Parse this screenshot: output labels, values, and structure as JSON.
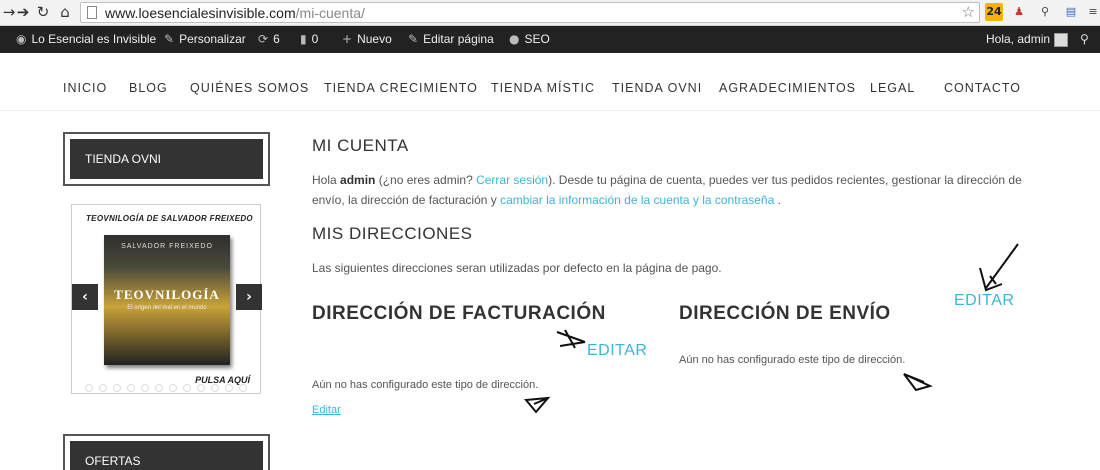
{
  "browser": {
    "url_host": "www.loesencialesinvisible.com",
    "url_path": "/mi-cuenta/",
    "ext_badge": "24"
  },
  "admin_bar": {
    "site_name": "Lo Esencial es Invisible",
    "customize": "Personalizar",
    "updates_count": "6",
    "comments_count": "0",
    "new": "Nuevo",
    "edit_page": "Editar página",
    "seo": "SEO",
    "greeting": "Hola, admin"
  },
  "nav": {
    "items": [
      "INICIO",
      "BLOG",
      "QUIÉNES SOMOS",
      "TIENDA CRECIMIENTO",
      "TIENDA MÍSTIC",
      "TIENDA OVNI",
      "AGRADECIMIENTOS",
      "LEGAL",
      "CONTACTO"
    ]
  },
  "sidebar": {
    "widget1_title": "TIENDA OVNI",
    "widget2_title": "OFERTAS",
    "slider_top_text": "TEOVNILOGÍA DE SALVADOR FREIXEDO",
    "book_author": "SALVADOR FREIXEDO",
    "book_title": "TEOVNILOGÍA",
    "book_subtitle": "El origen del mal en el mundo",
    "slider_bottom_text": "PULSA AQUÍ"
  },
  "account": {
    "title": "MI CUENTA",
    "intro_hello": "Hola ",
    "intro_user": "admin",
    "intro_q": " (¿no eres admin? ",
    "logout_link": "Cerrar sesión",
    "intro_rest": "). Desde tu página de cuenta, puedes ver tus pedidos recientes, gestionar la dirección de envío, la dirección de facturación y ",
    "change_link": "cambiar la información de la cuenta y la contraseña",
    "intro_end": " .",
    "addresses_title": "MIS DIRECCIONES",
    "addresses_desc": "Las siguientes direcciones seran utilizadas por defecto en la página de pago.",
    "billing_title": "DIRECCIÓN DE FACTURACIÓN",
    "billing_empty": "Aún no has configurado este tipo de dirección.",
    "billing_edit": "Editar",
    "shipping_title": "DIRECCIÓN DE ENVÍO",
    "shipping_empty": "Aún no has configurado este tipo de dirección.",
    "annot_editar_1": "EDITAR",
    "annot_editar_2": "EDITAR"
  }
}
